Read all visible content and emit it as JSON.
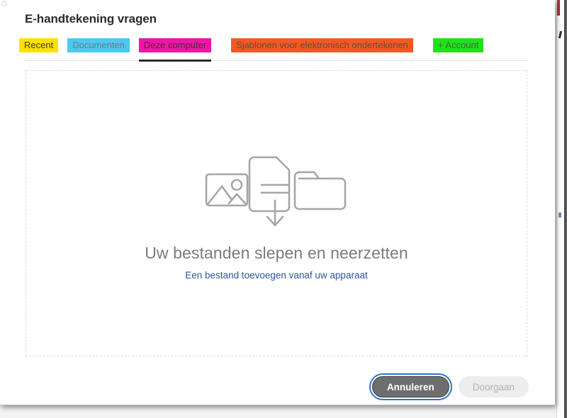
{
  "window": {
    "title": "E-handtekening vragen"
  },
  "tabs": [
    {
      "id": "recent",
      "label": "Recent",
      "highlight": "#ffe000",
      "text_color": "#3a3a3a",
      "active": false
    },
    {
      "id": "documenten",
      "label": "Documenten",
      "highlight": "#4dc8f0",
      "text_color": "#6a7d86",
      "active": false
    },
    {
      "id": "deze-computer",
      "label": "Deze computer",
      "highlight": "#ef15a6",
      "text_color": "#4a2940",
      "active": true
    },
    {
      "id": "sjablonen",
      "label": "Sjablonen voor elektronisch ondertekenen",
      "highlight": "#f15a22",
      "text_color": "#6d4a33",
      "active": false
    },
    {
      "id": "account",
      "label": "+ Account",
      "highlight": "#22e019",
      "text_color": "#3f6a3c",
      "active": false
    }
  ],
  "dropzone": {
    "headline": "Uw bestanden slepen en neerzetten",
    "link_label": "Een bestand toevoegen vanaf uw apparaat",
    "icons": [
      "image-icon",
      "document-download-icon",
      "folder-icon"
    ],
    "icon_color": "#a6a6a6",
    "border_style": "dashed",
    "border_color": "#dcdcdc"
  },
  "footer": {
    "cancel_label": "Annuleren",
    "continue_label": "Doorgaan",
    "continue_disabled": true,
    "cancel_focus_color": "#2a74d4"
  }
}
